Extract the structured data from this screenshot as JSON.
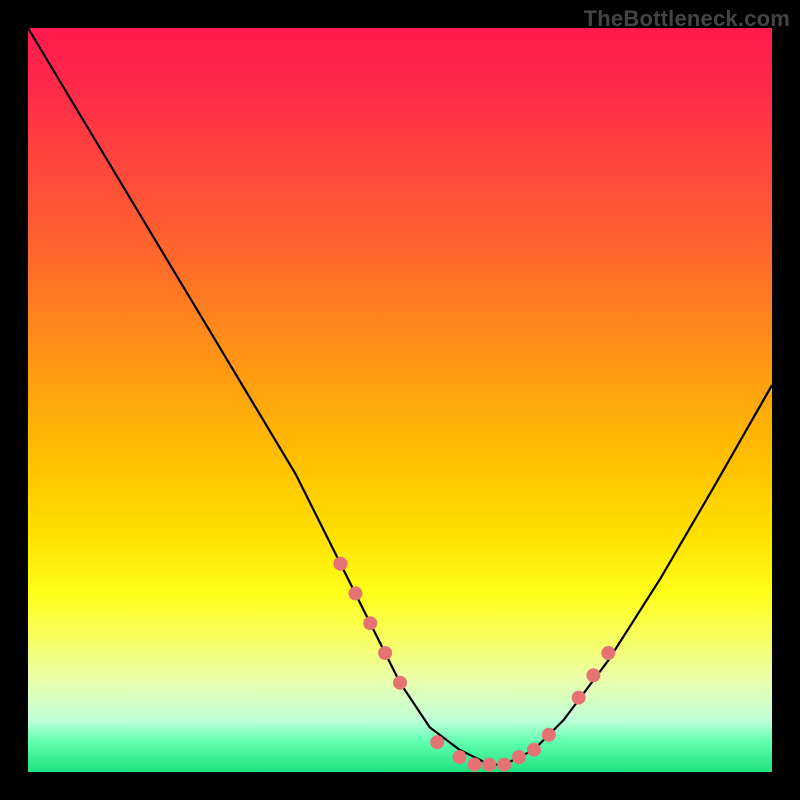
{
  "watermark": "TheBottleneck.com",
  "chart_data": {
    "type": "line",
    "title": "",
    "xlabel": "",
    "ylabel": "",
    "xlim": [
      0,
      100
    ],
    "ylim": [
      0,
      100
    ],
    "series": [
      {
        "name": "curve",
        "x": [
          0,
          6,
          12,
          18,
          24,
          30,
          36,
          42,
          46,
          50,
          54,
          58,
          62,
          64,
          68,
          72,
          78,
          85,
          92,
          100
        ],
        "values": [
          100,
          90,
          80,
          70,
          60,
          50,
          40,
          28,
          20,
          12,
          6,
          3,
          1,
          1,
          3,
          7,
          15,
          26,
          38,
          52
        ]
      }
    ],
    "markers": [
      {
        "x": 42,
        "y": 28
      },
      {
        "x": 44,
        "y": 24
      },
      {
        "x": 46,
        "y": 20
      },
      {
        "x": 48,
        "y": 16
      },
      {
        "x": 50,
        "y": 12
      },
      {
        "x": 55,
        "y": 4
      },
      {
        "x": 58,
        "y": 2
      },
      {
        "x": 60,
        "y": 1
      },
      {
        "x": 62,
        "y": 1
      },
      {
        "x": 64,
        "y": 1
      },
      {
        "x": 66,
        "y": 2
      },
      {
        "x": 68,
        "y": 3
      },
      {
        "x": 70,
        "y": 5
      },
      {
        "x": 74,
        "y": 10
      },
      {
        "x": 76,
        "y": 13
      },
      {
        "x": 78,
        "y": 16
      }
    ],
    "marker_color": "#e57373",
    "curve_color": "#000000"
  }
}
